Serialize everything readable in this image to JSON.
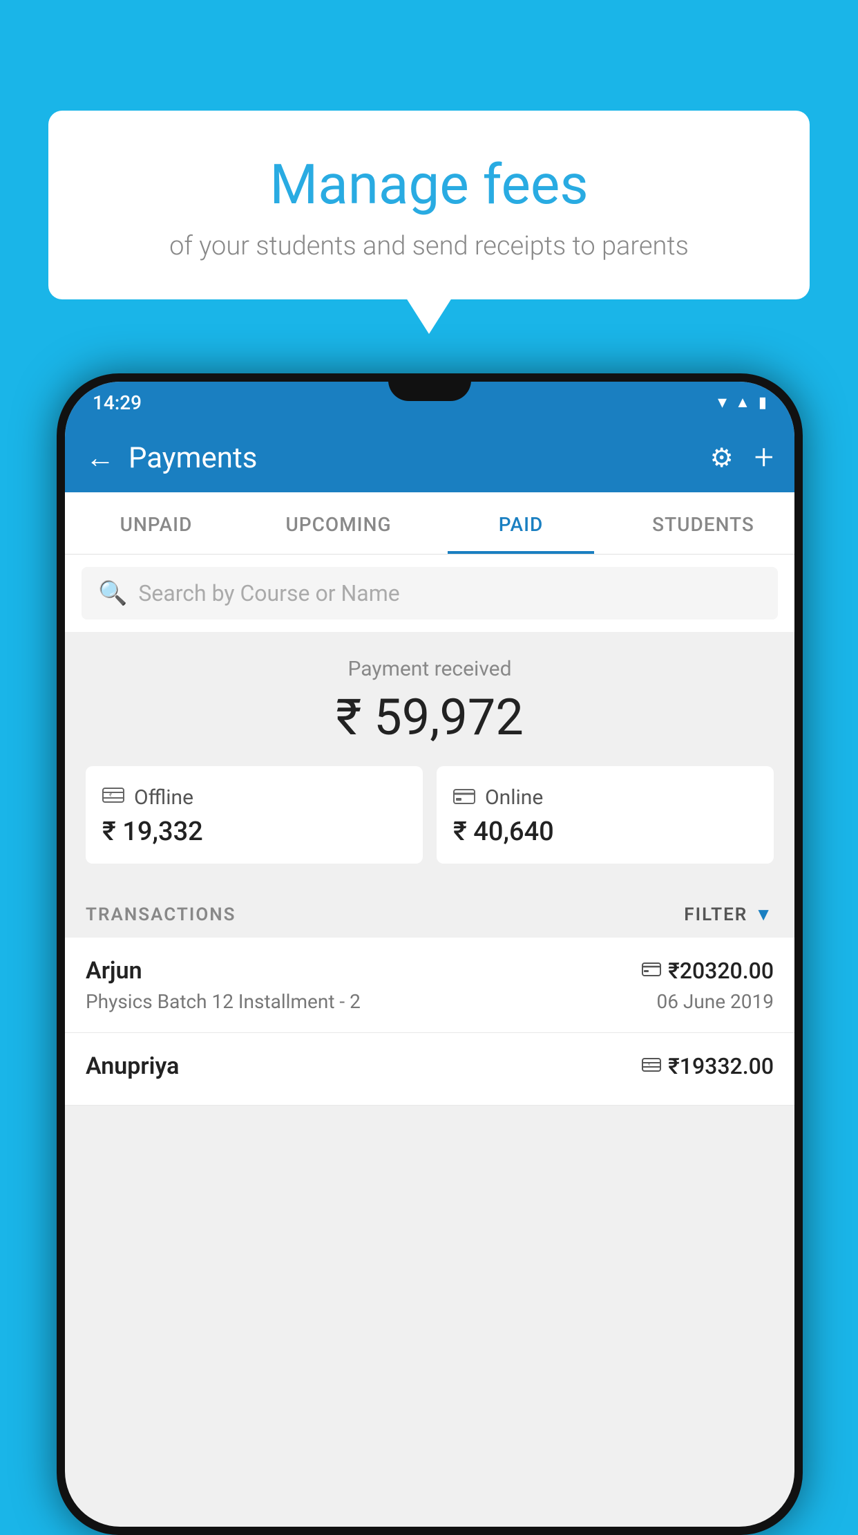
{
  "background_color": "#1ab5e8",
  "bubble": {
    "title": "Manage fees",
    "subtitle": "of your students and send receipts to parents"
  },
  "phone": {
    "status_bar": {
      "time": "14:29",
      "wifi": "wifi",
      "signal": "signal",
      "battery": "battery"
    },
    "header": {
      "back_label": "←",
      "title": "Payments",
      "gear_icon": "⚙",
      "plus_icon": "+"
    },
    "tabs": [
      {
        "label": "UNPAID",
        "active": false
      },
      {
        "label": "UPCOMING",
        "active": false
      },
      {
        "label": "PAID",
        "active": true
      },
      {
        "label": "STUDENTS",
        "active": false
      }
    ],
    "search": {
      "placeholder": "Search by Course or Name",
      "icon": "🔍"
    },
    "payment_summary": {
      "label": "Payment received",
      "amount": "₹ 59,972",
      "offline": {
        "label": "Offline",
        "amount": "₹ 19,332",
        "icon": "💳"
      },
      "online": {
        "label": "Online",
        "amount": "₹ 40,640",
        "icon": "💳"
      }
    },
    "transactions": {
      "header_label": "TRANSACTIONS",
      "filter_label": "FILTER",
      "rows": [
        {
          "name": "Arjun",
          "amount": "₹20320.00",
          "course": "Physics Batch 12 Installment - 2",
          "date": "06 June 2019",
          "payment_type": "online"
        },
        {
          "name": "Anupriya",
          "amount": "₹19332.00",
          "course": "",
          "date": "",
          "payment_type": "offline"
        }
      ]
    }
  }
}
